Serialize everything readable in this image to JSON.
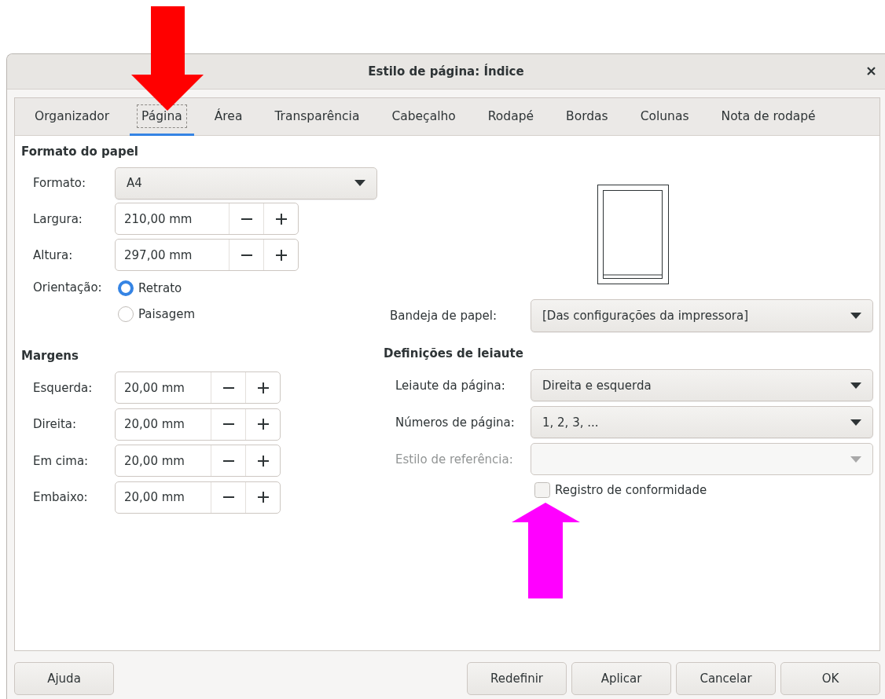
{
  "window": {
    "title": "Estilo de página: Índice"
  },
  "tabs": [
    {
      "label": "Organizador",
      "selected": false
    },
    {
      "label": "Página",
      "selected": true
    },
    {
      "label": "Área",
      "selected": false
    },
    {
      "label": "Transparência",
      "selected": false
    },
    {
      "label": "Cabeçalho",
      "selected": false
    },
    {
      "label": "Rodapé",
      "selected": false
    },
    {
      "label": "Bordas",
      "selected": false
    },
    {
      "label": "Colunas",
      "selected": false
    },
    {
      "label": "Nota de rodapé",
      "selected": false
    }
  ],
  "paper_format": {
    "heading": "Formato do papel",
    "format": {
      "label": "Formato:",
      "value": "A4"
    },
    "width": {
      "label": "Largura:",
      "value": "210,00 mm"
    },
    "height": {
      "label": "Altura:",
      "value": "297,00 mm"
    },
    "orientation": {
      "label": "Orientação:",
      "options": [
        {
          "label": "Retrato",
          "selected": true
        },
        {
          "label": "Paisagem",
          "selected": false
        }
      ]
    }
  },
  "paper_tray": {
    "label": "Bandeja de papel:",
    "value": "[Das configurações da impressora]"
  },
  "margins": {
    "heading": "Margens",
    "fields": [
      {
        "label": "Esquerda:",
        "value": "20,00 mm"
      },
      {
        "label": "Direita:",
        "value": "20,00 mm"
      },
      {
        "label": "Em cima:",
        "value": "20,00 mm"
      },
      {
        "label": "Embaixo:",
        "value": "20,00 mm"
      }
    ]
  },
  "layout_settings": {
    "heading": "Definições de leiaute",
    "fields": [
      {
        "label": "Leiaute da página:",
        "value": "Direita e esquerda",
        "disabled": false
      },
      {
        "label": "Números de página:",
        "value": "1, 2, 3, ...",
        "disabled": false
      },
      {
        "label": "Estilo de referência:",
        "disabled": true
      }
    ],
    "register_true": {
      "label": "Registro de conformidade",
      "checked": false
    }
  },
  "buttons": [
    {
      "label": "Ajuda"
    },
    {
      "label": "Redefinir"
    },
    {
      "label": "Aplicar"
    },
    {
      "label": "Cancelar"
    },
    {
      "label": "OK"
    }
  ],
  "annotations": [
    {
      "kind": "down_arrow",
      "color": "#ff0000"
    },
    {
      "kind": "up_arrow",
      "color": "#ff00ff"
    }
  ]
}
